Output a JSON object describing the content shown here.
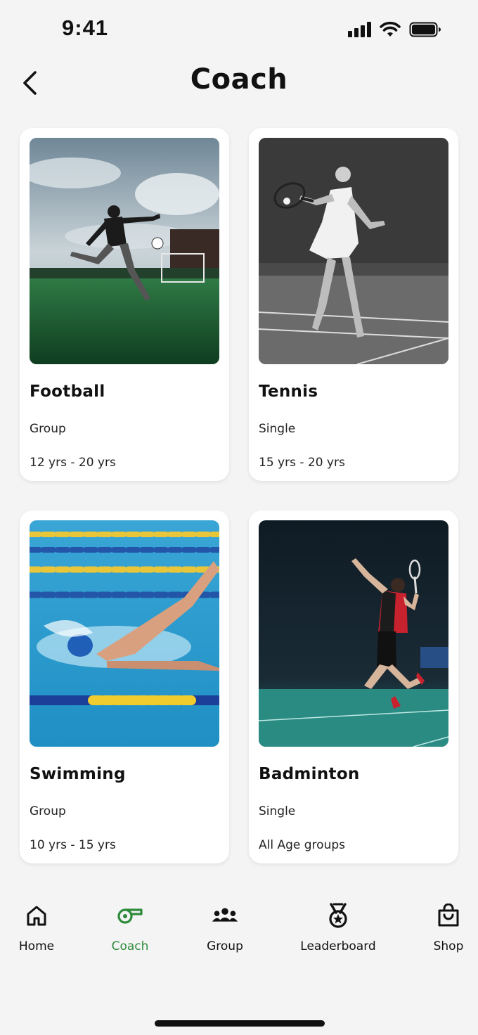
{
  "status_bar": {
    "time": "9:41"
  },
  "header": {
    "title": "Coach"
  },
  "cards": [
    {
      "title": "Football",
      "type": "Group",
      "age": "12 yrs - 20 yrs",
      "image": "football-player-kicking-ball"
    },
    {
      "title": "Tennis",
      "type": "Single",
      "age": "15 yrs - 20 yrs",
      "image": "tennis-player-forehand"
    },
    {
      "title": "Swimming",
      "type": "Group",
      "age": "10 yrs - 15 yrs",
      "image": "swimmer-freestyle-pool"
    },
    {
      "title": "Badminton",
      "type": "Single",
      "age": "All Age groups",
      "image": "badminton-player-jump-smash"
    }
  ],
  "nav": {
    "items": [
      {
        "label": "Home",
        "icon": "home-icon"
      },
      {
        "label": "Coach",
        "icon": "whistle-icon",
        "active": true
      },
      {
        "label": "Group",
        "icon": "group-icon"
      },
      {
        "label": "Leaderboard",
        "icon": "medal-icon"
      },
      {
        "label": "Shop",
        "icon": "shopping-bag-icon"
      }
    ]
  },
  "colors": {
    "accent": "#2e8b3c",
    "background": "#f4f4f4",
    "card": "#ffffff",
    "text": "#111111"
  }
}
